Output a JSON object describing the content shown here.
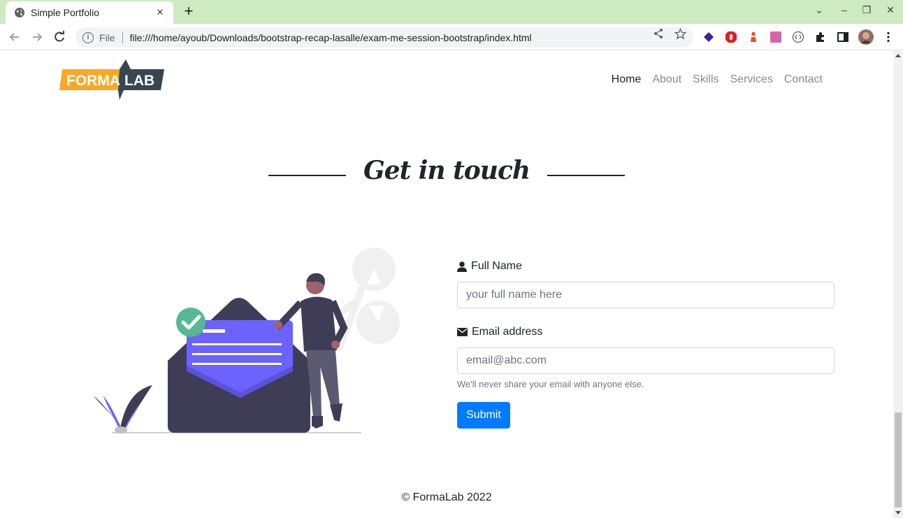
{
  "browser": {
    "tab_title": "Simple Portfolio",
    "tab_close": "✕",
    "new_tab": "+",
    "url_scheme_label": "File",
    "url": "file:///home/ayoub/Downloads/bootstrap-recap-lasalle/exam-me-session-bootstrap/index.html",
    "window_controls": [
      "⌄",
      "–",
      "❐",
      "✕"
    ]
  },
  "site": {
    "logo_part1": "FORMA",
    "logo_part2": "LAB",
    "nav": [
      {
        "label": "Home",
        "active": true
      },
      {
        "label": "About",
        "active": false
      },
      {
        "label": "Skills",
        "active": false
      },
      {
        "label": "Services",
        "active": false
      },
      {
        "label": "Contact",
        "active": false
      }
    ],
    "section_title": "Get in touch"
  },
  "form": {
    "name_label": "Full Name",
    "name_placeholder": "your full name here",
    "email_label": "Email address",
    "email_placeholder": "email@abc.com",
    "email_help": "We'll never share your email with anyone else.",
    "submit_label": "Submit"
  },
  "footer": {
    "text": "© FormaLab 2022"
  },
  "colors": {
    "tabbar": "#cdeac0",
    "primary": "#007bff",
    "logo_yellow": "#f9a825",
    "logo_dark": "#37474f",
    "illus_purple": "#6c63ff",
    "illus_dark": "#3f3d56",
    "illus_green": "#57b894"
  }
}
